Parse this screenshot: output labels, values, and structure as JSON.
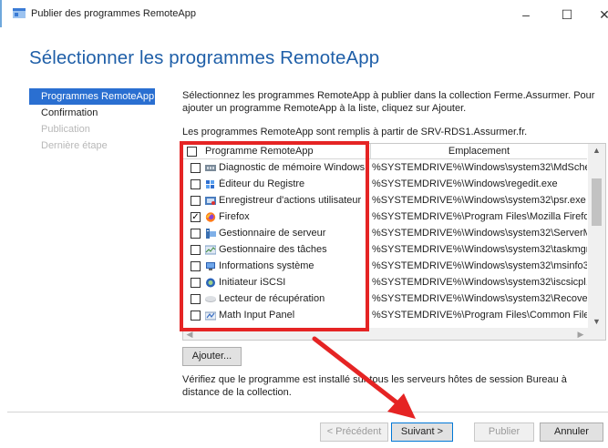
{
  "window": {
    "title": "Publier des programmes RemoteApp",
    "minimize": "–",
    "maximize": "☐",
    "close": "✕"
  },
  "heading": "Sélectionner les programmes RemoteApp",
  "nav": {
    "items": [
      {
        "label": "Programmes RemoteApp",
        "state": "active"
      },
      {
        "label": "Confirmation",
        "state": "normal"
      },
      {
        "label": "Publication",
        "state": "disabled"
      },
      {
        "label": "Dernière étape",
        "state": "disabled"
      }
    ]
  },
  "description": "Sélectionnez les programmes RemoteApp à publier dans la collection Ferme.Assurmer. Pour ajouter un programme RemoteApp à la liste, cliquez sur Ajouter.",
  "source_text": "Les programmes RemoteApp sont remplis à partir de SRV-RDS1.Assurmer.fr.",
  "grid": {
    "headers": {
      "program": "Programme RemoteApp",
      "location": "Emplacement"
    },
    "rows": [
      {
        "name": "Diagnostic de mémoire Windows",
        "location": "%SYSTEMDRIVE%\\Windows\\system32\\MdSche...",
        "checked": "",
        "icon": "memory-diagnostic-icon"
      },
      {
        "name": "Éditeur du Registre",
        "location": "%SYSTEMDRIVE%\\Windows\\regedit.exe",
        "checked": "",
        "icon": "registry-editor-icon"
      },
      {
        "name": "Enregistreur d'actions utilisateur",
        "location": "%SYSTEMDRIVE%\\Windows\\system32\\psr.exe",
        "checked": "",
        "icon": "steps-recorder-icon"
      },
      {
        "name": "Firefox",
        "location": "%SYSTEMDRIVE%\\Program Files\\Mozilla Firefox...",
        "checked": "✓",
        "icon": "firefox-icon"
      },
      {
        "name": "Gestionnaire de serveur",
        "location": "%SYSTEMDRIVE%\\Windows\\system32\\ServerM...",
        "checked": "",
        "icon": "server-manager-icon"
      },
      {
        "name": "Gestionnaire des tâches",
        "location": "%SYSTEMDRIVE%\\Windows\\system32\\taskmgr....",
        "checked": "",
        "icon": "task-manager-icon"
      },
      {
        "name": "Informations système",
        "location": "%SYSTEMDRIVE%\\Windows\\system32\\msinfo3...",
        "checked": "",
        "icon": "system-information-icon"
      },
      {
        "name": "Initiateur iSCSI",
        "location": "%SYSTEMDRIVE%\\Windows\\system32\\iscsicpl.e...",
        "checked": "",
        "icon": "iscsi-initiator-icon"
      },
      {
        "name": "Lecteur de récupération",
        "location": "%SYSTEMDRIVE%\\Windows\\system32\\Recovery...",
        "checked": "",
        "icon": "recovery-drive-icon"
      },
      {
        "name": "Math Input Panel",
        "location": "%SYSTEMDRIVE%\\Program Files\\Common Files...",
        "checked": "",
        "icon": "math-input-panel-icon"
      }
    ],
    "scroll_up": "▲",
    "scroll_down": "▼",
    "scroll_left": "◀",
    "scroll_right": "▶"
  },
  "buttons": {
    "add": "Ajouter...",
    "previous": "< Précédent",
    "next": "Suivant >",
    "publish": "Publier",
    "cancel": "Annuler"
  },
  "note": "Vérifiez que le programme est installé sur tous les serveurs hôtes de session Bureau à distance de la collection.",
  "colors": {
    "accent": "#2a6fd1",
    "heading": "#1f5fa8",
    "annotation": "#e52424"
  }
}
